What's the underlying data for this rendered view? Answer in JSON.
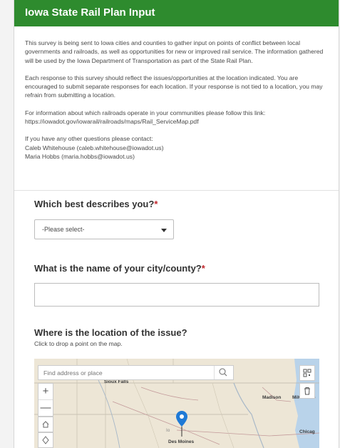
{
  "survey": {
    "title": "Iowa State Rail Plan Input",
    "description": [
      "This survey is being sent to Iowa cities and counties to gather input on points of conflict between local governments and railroads, as well as opportunities for new or improved rail service. The information gathered will be used by the Iowa Department of Transportation as part of the State Rail Plan.",
      "Each response to this survey should reflect the issues/opportunities at the location indicated. You are encouraged to submit separate responses for each location. If your response is not tied to a location, you may refrain from submitting a location.",
      "For information about which railroads operate in your communities please follow this link: https://iowadot.gov/iowarail/railroads/maps/Rail_ServiceMap.pdf",
      "If you have any other questions please contact:",
      "Caleb Whitehouse (caleb.whitehouse@iowadot.us)",
      "Maria Hobbs (maria.hobbs@iowadot.us)"
    ]
  },
  "questions": {
    "describes": {
      "label": "Which best describes you?",
      "required_mark": "*",
      "selected": "-Please select-"
    },
    "city": {
      "label": "What is the name of your city/county?",
      "required_mark": "*",
      "value": ""
    },
    "location": {
      "label": "Where is the location of the issue?",
      "hint": "Click to drop a point on the map."
    }
  },
  "map": {
    "search_placeholder": "Find address or place",
    "zoom_in": "+",
    "zoom_out": "—",
    "labels": {
      "sioux_falls": "Sioux Falls",
      "madison": "Madison",
      "milwaukee": "Milwaukee",
      "chicago": "Chicag",
      "des_moines": "Des Moines",
      "iowa": "Io"
    },
    "icons": [
      "search-icon",
      "qr-code-icon",
      "trash-icon",
      "home-icon",
      "locate-icon",
      "map-pin-icon"
    ],
    "colors": {
      "pin": "#1f7ad6",
      "water": "#b9d3ea",
      "land": "#ede6d6"
    }
  },
  "theme": {
    "header_bg": "#2e8b2e",
    "required": "#c0282d"
  }
}
